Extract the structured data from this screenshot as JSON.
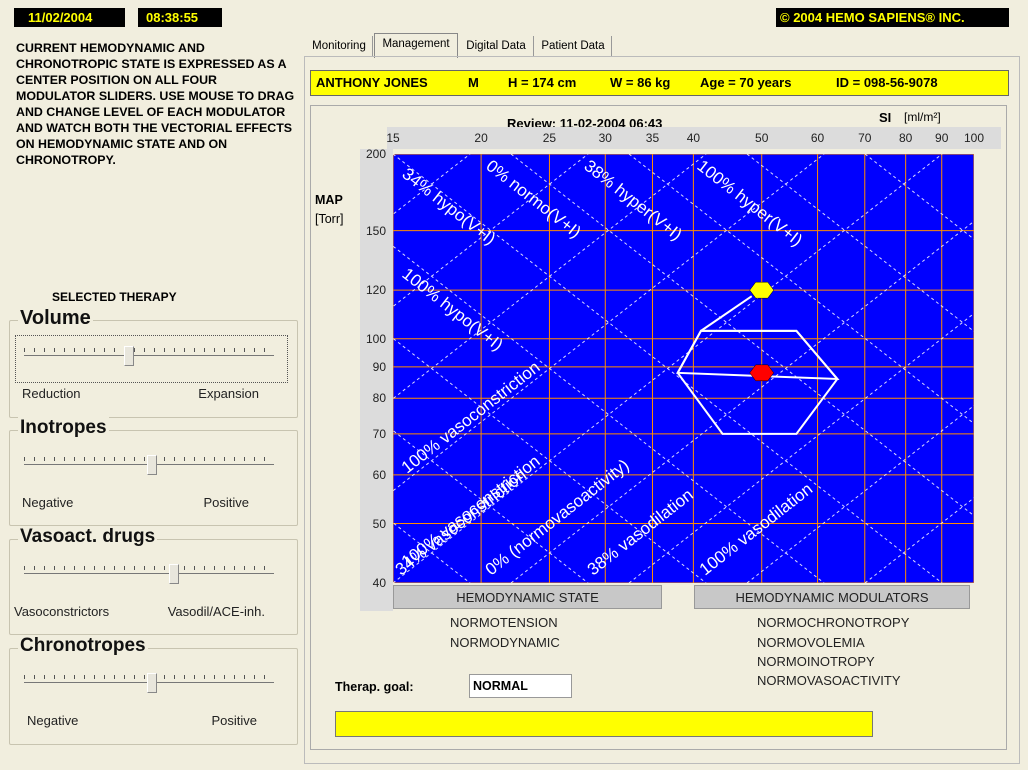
{
  "header": {
    "date": "11/02/2004",
    "time": "08:38:55",
    "copyright": "© 2004 HEMO SAPIENS® INC."
  },
  "instructions": "CURRENT HEMODYNAMIC AND CHRONOTROPIC STATE IS EXPRESSED AS A CENTER POSITION ON ALL FOUR MODULATOR SLIDERS. USE MOUSE TO DRAG AND CHANGE LEVEL OF EACH MODULATOR AND WATCH BOTH THE VECTORIAL EFFECTS ON HEMODYNAMIC STATE AND ON CHRONOTROPY.",
  "selected_therapy": "SELECTED THERAPY",
  "sliders": [
    {
      "title": "Volume",
      "left": "Reduction",
      "right": "Expansion",
      "level": 0.42
    },
    {
      "title": "Inotropes",
      "left": "Negative",
      "right": "Positive",
      "level": 0.51
    },
    {
      "title": "Vasoact. drugs",
      "left": "Vasoconstrictors",
      "right": "Vasodil/ACE-inh.",
      "level": 0.6
    },
    {
      "title": "Chronotropes",
      "left": "Negative",
      "right": "Positive",
      "level": 0.51
    }
  ],
  "tabs": [
    "Monitoring",
    "Management",
    "Digital Data",
    "Patient Data"
  ],
  "active_tab": "Management",
  "patient": {
    "name": "ANTHONY JONES",
    "sex": "M",
    "height": "H = 174 cm",
    "weight": "W = 86 kg",
    "age": "Age = 70 years",
    "id": "ID = 098-56-9078"
  },
  "review": "Review: 11-02-2004 06:43",
  "si_label": "SI",
  "si_unit": "[ml/m²]",
  "map_label": "MAP",
  "map_unit": "[Torr]",
  "chart_data": {
    "type": "scatter",
    "x_ticks": [
      15,
      20,
      25,
      30,
      35,
      40,
      50,
      60,
      70,
      80,
      90,
      100
    ],
    "y_ticks": [
      40,
      50,
      60,
      70,
      80,
      90,
      100,
      120,
      150,
      200
    ],
    "x_scale": "log",
    "y_scale": "log",
    "xlim": [
      15,
      100
    ],
    "ylim": [
      40,
      200
    ],
    "grid": true,
    "iso_line_labels": [
      "34% hypo(V+I)",
      "0% normo(V+I)",
      "38% hyper(V+I)",
      "100% hyper(V+I)",
      "100% hypo(V+I)",
      "100% vasoconstriction",
      "100% vasoconstriction",
      "34% vasoconstriction",
      "0% (normovasoactivity)",
      "38% vasodilation",
      "100% vasodilation"
    ],
    "target_point": {
      "si": 50,
      "map": 120,
      "color": "#ffff00"
    },
    "current_point": {
      "si": 50,
      "map": 88,
      "color": "#ff0000"
    },
    "normal_region": [
      [
        38,
        88
      ],
      [
        41,
        103
      ],
      [
        56,
        103
      ],
      [
        64,
        86
      ],
      [
        56,
        70
      ],
      [
        44,
        70
      ]
    ]
  },
  "buttons": {
    "state": "HEMODYNAMIC STATE",
    "modulators": "HEMODYNAMIC MODULATORS"
  },
  "state_text": [
    "NORMOTENSION",
    "NORMODYNAMIC"
  ],
  "modulator_text": [
    "NORMOCHRONOTROPY",
    "NORMOVOLEMIA",
    "NORMOINOTROPY",
    "NORMOVASOACTIVITY"
  ],
  "therapy_goal_label": "Therap. goal:",
  "therapy_goal_value": "NORMAL",
  "message": ""
}
